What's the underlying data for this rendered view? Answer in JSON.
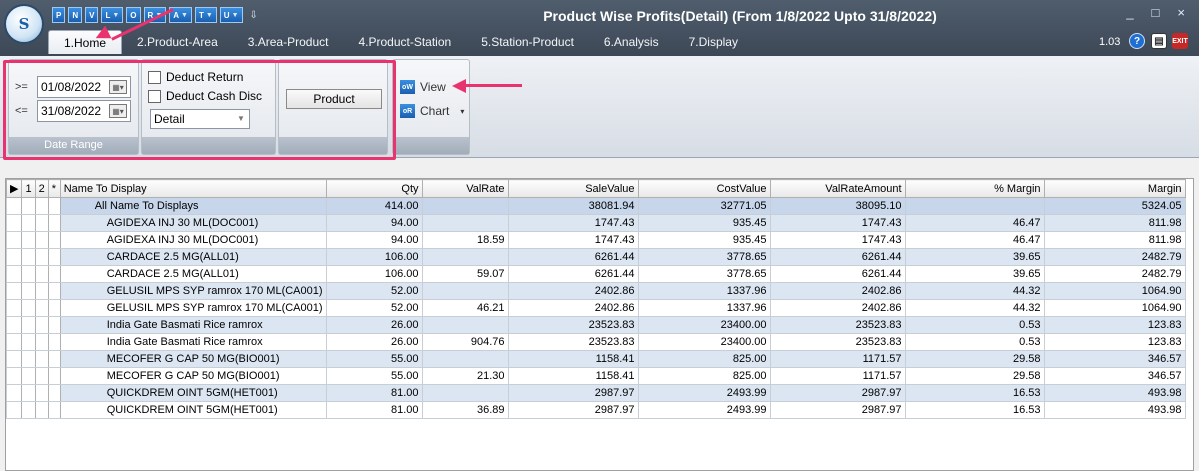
{
  "window": {
    "title": "Product Wise Profits(Detail) (From 1/8/2022 Upto 31/8/2022)",
    "controls": [
      "_",
      "□",
      "×"
    ],
    "version": "1.03",
    "logo_text": "S"
  },
  "quick_access": [
    {
      "label": "P"
    },
    {
      "label": "N"
    },
    {
      "label": "V"
    },
    {
      "label": "L"
    },
    {
      "label": "O"
    },
    {
      "label": "R"
    },
    {
      "label": "A"
    },
    {
      "label": "T"
    },
    {
      "label": "U"
    }
  ],
  "tabs": [
    {
      "label": "1.Home"
    },
    {
      "label": "2.Product-Area"
    },
    {
      "label": "3.Area-Product"
    },
    {
      "label": "4.Product-Station"
    },
    {
      "label": "5.Station-Product"
    },
    {
      "label": "6.Analysis"
    },
    {
      "label": "7.Display"
    }
  ],
  "ribbon": {
    "date_range": {
      "caption": "Date Range",
      "from_op": ">=",
      "from": "01/08/2022",
      "to_op": "<=",
      "to": "31/08/2022"
    },
    "options": {
      "deduct_return": "Deduct Return",
      "deduct_cash_disc": "Deduct Cash Disc",
      "mode": "Detail"
    },
    "product_button": "Product",
    "view_button": "View",
    "chart_button": "Chart"
  },
  "grid": {
    "levels": [
      "1",
      "2",
      "*"
    ],
    "columns": [
      "Name To Display",
      "Qty",
      "ValRate",
      "SaleValue",
      "CostValue",
      "ValRateAmount",
      "% Margin",
      "Margin"
    ],
    "rows": [
      {
        "name": "All Name To Displays",
        "qty": "414.00",
        "valrate": "",
        "sale": "38081.94",
        "cost": "32771.05",
        "vramt": "38095.10",
        "pmargin": "",
        "margin": "5324.05",
        "group": true
      },
      {
        "name": "AGIDEXA INJ 30 ML(DOC001)",
        "qty": "94.00",
        "valrate": "",
        "sale": "1747.43",
        "cost": "935.45",
        "vramt": "1747.43",
        "pmargin": "46.47",
        "margin": "811.98"
      },
      {
        "name": "AGIDEXA INJ 30 ML(DOC001)",
        "qty": "94.00",
        "valrate": "18.59",
        "sale": "1747.43",
        "cost": "935.45",
        "vramt": "1747.43",
        "pmargin": "46.47",
        "margin": "811.98"
      },
      {
        "name": "CARDACE 2.5 MG(ALL01)",
        "qty": "106.00",
        "valrate": "",
        "sale": "6261.44",
        "cost": "3778.65",
        "vramt": "6261.44",
        "pmargin": "39.65",
        "margin": "2482.79"
      },
      {
        "name": "CARDACE 2.5 MG(ALL01)",
        "qty": "106.00",
        "valrate": "59.07",
        "sale": "6261.44",
        "cost": "3778.65",
        "vramt": "6261.44",
        "pmargin": "39.65",
        "margin": "2482.79"
      },
      {
        "name": "GELUSIL MPS SYP ramrox 170 ML(CA001)",
        "qty": "52.00",
        "valrate": "",
        "sale": "2402.86",
        "cost": "1337.96",
        "vramt": "2402.86",
        "pmargin": "44.32",
        "margin": "1064.90"
      },
      {
        "name": "GELUSIL MPS SYP ramrox 170 ML(CA001)",
        "qty": "52.00",
        "valrate": "46.21",
        "sale": "2402.86",
        "cost": "1337.96",
        "vramt": "2402.86",
        "pmargin": "44.32",
        "margin": "1064.90"
      },
      {
        "name": "India Gate Basmati Rice ramrox",
        "qty": "26.00",
        "valrate": "",
        "sale": "23523.83",
        "cost": "23400.00",
        "vramt": "23523.83",
        "pmargin": "0.53",
        "margin": "123.83"
      },
      {
        "name": "India Gate Basmati Rice ramrox",
        "qty": "26.00",
        "valrate": "904.76",
        "sale": "23523.83",
        "cost": "23400.00",
        "vramt": "23523.83",
        "pmargin": "0.53",
        "margin": "123.83"
      },
      {
        "name": "MECOFER G CAP 50 MG(BIO001)",
        "qty": "55.00",
        "valrate": "",
        "sale": "1158.41",
        "cost": "825.00",
        "vramt": "1171.57",
        "pmargin": "29.58",
        "margin": "346.57"
      },
      {
        "name": "MECOFER G CAP 50 MG(BIO001)",
        "qty": "55.00",
        "valrate": "21.30",
        "sale": "1158.41",
        "cost": "825.00",
        "vramt": "1171.57",
        "pmargin": "29.58",
        "margin": "346.57"
      },
      {
        "name": "QUICKDREM OINT 5GM(HET001)",
        "qty": "81.00",
        "valrate": "",
        "sale": "2987.97",
        "cost": "2493.99",
        "vramt": "2987.97",
        "pmargin": "16.53",
        "margin": "493.98"
      },
      {
        "name": "QUICKDREM OINT 5GM(HET001)",
        "qty": "81.00",
        "valrate": "36.89",
        "sale": "2987.97",
        "cost": "2493.99",
        "vramt": "2987.97",
        "pmargin": "16.53",
        "margin": "493.98"
      }
    ]
  },
  "colors": {
    "highlight": "#e8336e",
    "row_alt": "#dce6f2",
    "row_group": "#c7d6ea"
  }
}
